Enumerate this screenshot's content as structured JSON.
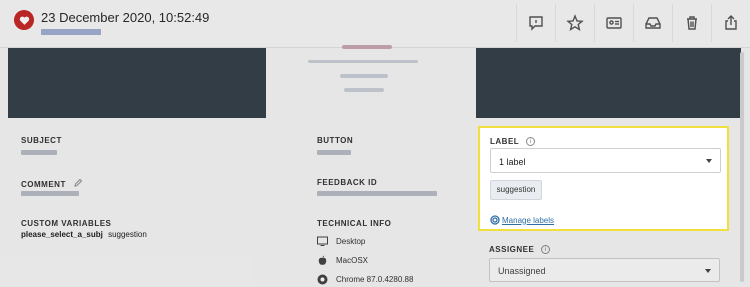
{
  "header": {
    "timestamp": "23 December 2020, 10:52:49"
  },
  "toolbar": {
    "icons": [
      "feedback-icon",
      "star-icon",
      "id-card-icon",
      "inbox-icon",
      "trash-icon",
      "share-icon"
    ]
  },
  "fields": {
    "subject_label": "SUBJECT",
    "button_label": "BUTTON",
    "comment_label": "COMMENT",
    "feedback_id_label": "FEEDBACK ID",
    "custom_variables_label": "CUSTOM VARIABLES",
    "technical_info_label": "TECHNICAL INFO"
  },
  "custom_variables": {
    "key": "please_select_a_subj",
    "value": "suggestion"
  },
  "technical_info": {
    "device": "Desktop",
    "os": "MacOSX",
    "browser": "Chrome 87.0.4280.88"
  },
  "label_panel": {
    "heading": "LABEL",
    "selected": "1 label",
    "tag": "suggestion",
    "manage_link": "Manage labels"
  },
  "assignee": {
    "heading": "ASSIGNEE",
    "selected": "Unassigned"
  },
  "colors": {
    "highlight_border": "#f0df3c",
    "badge_red": "#c62828",
    "link_blue": "#2f6fa8",
    "screenshot_dark": "#37414a"
  }
}
